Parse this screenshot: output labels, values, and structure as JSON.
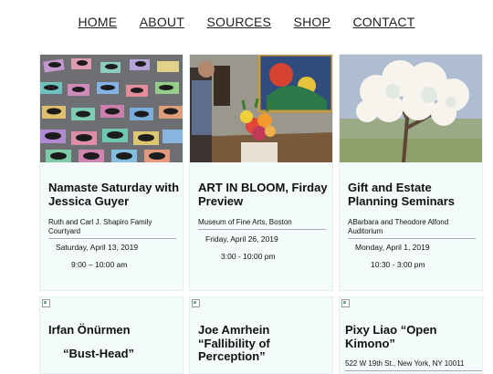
{
  "nav": [
    "HOME",
    "ABOUT",
    "SOURCES",
    "SHOP",
    "CONTACT"
  ],
  "events": [
    {
      "title": "Namaste Saturday with Jessica Guyer",
      "venue": "Ruth and Carl J. Shapiro Family Courtyard",
      "date": "Saturday, April 13, 2019",
      "time": "9:00 – 10:00 am",
      "image": "yoga-class-photo"
    },
    {
      "title": "ART IN BLOOM, Firday Preview",
      "venue": "Museum of Fine Arts, Boston",
      "date": "Friday, April 26, 2019",
      "time": "3:00 - 10:00 pm",
      "image": "gallery-flowers-photo"
    },
    {
      "title": "Gift and Estate Planning Seminars",
      "venue": "ABarbara and Theodore Alfond Auditorium",
      "date": "Monday, April 1, 2019",
      "time": "10:30 - 3:00 pm",
      "image": "blossom-tree-painting"
    }
  ],
  "lower_events": [
    {
      "title": "Irfan Önürmen",
      "subtitle": "“Bust-Head”"
    },
    {
      "title": "Joe Amrhein “Fallibility of Perception”"
    },
    {
      "title": "Pixy Liao “Open Kimono”",
      "venue": "522 W 19th St., New York, NY 10011"
    }
  ]
}
